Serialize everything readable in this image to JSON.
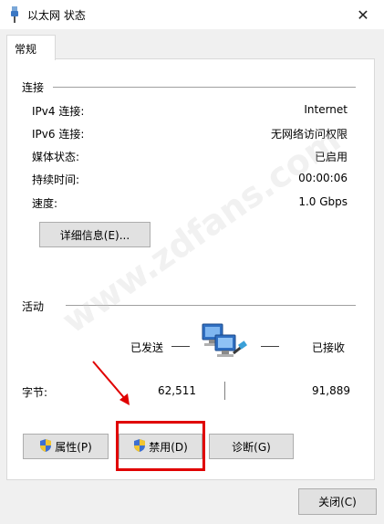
{
  "window": {
    "title": "以太网 状态",
    "close_symbol": "✕"
  },
  "tabs": [
    {
      "label": "常规"
    }
  ],
  "connection": {
    "heading": "连接",
    "rows": [
      {
        "label": "IPv4 连接:",
        "value": "Internet"
      },
      {
        "label": "IPv6 连接:",
        "value": "无网络访问权限"
      },
      {
        "label": "媒体状态:",
        "value": "已启用"
      },
      {
        "label": "持续时间:",
        "value": "00:00:06"
      },
      {
        "label": "速度:",
        "value": "1.0 Gbps"
      }
    ],
    "details_button": "详细信息(E)..."
  },
  "activity": {
    "heading": "活动",
    "sent_label": "已发送",
    "received_label": "已接收",
    "bytes_label": "字节:",
    "bytes_sent": "62,511",
    "bytes_received": "91,889"
  },
  "buttons": {
    "properties": "属性(P)",
    "disable": "禁用(D)",
    "diagnose": "诊断(G)",
    "close": "关闭(C)"
  },
  "annotation": {
    "color": "#e00000"
  },
  "watermark": {
    "text": "www.zdfans.com"
  },
  "icons": {
    "window": "network-cable-icon",
    "network": "network-computers-icon",
    "shield": "uac-shield-icon"
  }
}
